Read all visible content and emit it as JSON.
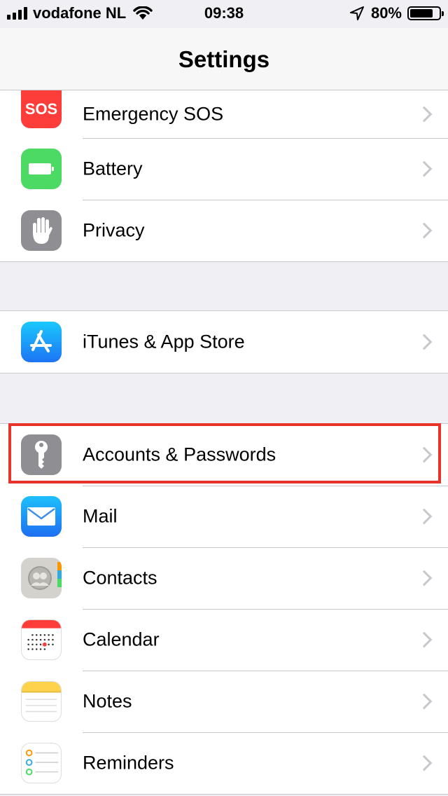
{
  "status_bar": {
    "carrier": "vodafone NL",
    "time": "09:38",
    "battery_percent_label": "80%",
    "battery_level": 0.8,
    "icons": [
      "signal-bars-icon",
      "wifi-icon",
      "location-arrow-icon",
      "battery-icon"
    ]
  },
  "nav": {
    "title": "Settings"
  },
  "groups": [
    {
      "items": [
        {
          "label": "Emergency SOS",
          "icon": "sos-icon",
          "icon_text": "SOS",
          "color": "#fc3d39"
        },
        {
          "label": "Battery",
          "icon": "battery-app-icon",
          "color": "#4cd964"
        },
        {
          "label": "Privacy",
          "icon": "hand-icon",
          "color": "#8e8e93"
        }
      ]
    },
    {
      "items": [
        {
          "label": "iTunes & App Store",
          "icon": "app-store-icon",
          "color": "#1e90f8"
        }
      ]
    },
    {
      "items": [
        {
          "label": "Accounts & Passwords",
          "icon": "key-icon",
          "color": "#8e8e93",
          "highlighted": true
        },
        {
          "label": "Mail",
          "icon": "mail-icon",
          "color": "#2a8ff6"
        },
        {
          "label": "Contacts",
          "icon": "contacts-icon",
          "color": "#d4d2cd"
        },
        {
          "label": "Calendar",
          "icon": "calendar-icon",
          "color": "#ffffff"
        },
        {
          "label": "Notes",
          "icon": "notes-icon",
          "color": "#ffffff"
        },
        {
          "label": "Reminders",
          "icon": "reminders-icon",
          "color": "#ffffff"
        }
      ]
    }
  ],
  "colors": {
    "highlight_frame": "#e8322a",
    "separator": "#c8c7cc",
    "background": "#efeff4"
  }
}
